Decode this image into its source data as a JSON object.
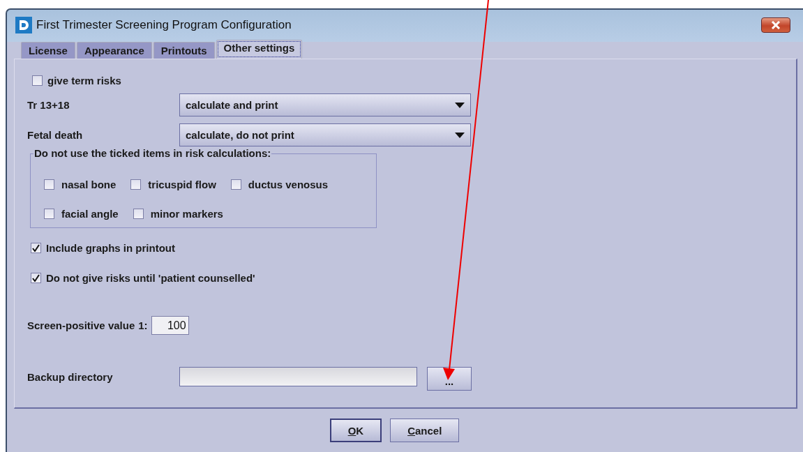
{
  "window": {
    "title": "First Trimester Screening Program Configuration"
  },
  "tabs": [
    {
      "label": "License",
      "selected": false
    },
    {
      "label": "Appearance",
      "selected": false
    },
    {
      "label": "Printouts",
      "selected": false
    },
    {
      "label": "Other settings",
      "selected": true
    }
  ],
  "give_term_risks": {
    "label": "give term risks",
    "checked": false
  },
  "dropdowns": [
    {
      "label": "Tr 13+18",
      "value": "calculate and print"
    },
    {
      "label": "Fetal death",
      "value": "calculate, do not print"
    }
  ],
  "exclusions": {
    "legend": "Do not use the ticked items in risk calculations:",
    "rows": [
      [
        {
          "label": "nasal bone",
          "checked": false
        },
        {
          "label": "tricuspid flow",
          "checked": false
        },
        {
          "label": "ductus venosus",
          "checked": false
        }
      ],
      [
        {
          "label": "facial angle",
          "checked": false
        },
        {
          "label": "minor markers",
          "checked": false
        }
      ]
    ]
  },
  "options": [
    {
      "label": "Include graphs in printout",
      "checked": true
    },
    {
      "label": "Do not give risks until 'patient counselled'",
      "checked": true
    }
  ],
  "screen_positive": {
    "label": "Screen-positive value",
    "prefix": "1:",
    "value": "100"
  },
  "backup_directory": {
    "label": "Backup directory",
    "browse_button": "..."
  },
  "buttons": [
    {
      "label": "OK",
      "default": true
    },
    {
      "label": "Cancel",
      "default": false
    }
  ]
}
